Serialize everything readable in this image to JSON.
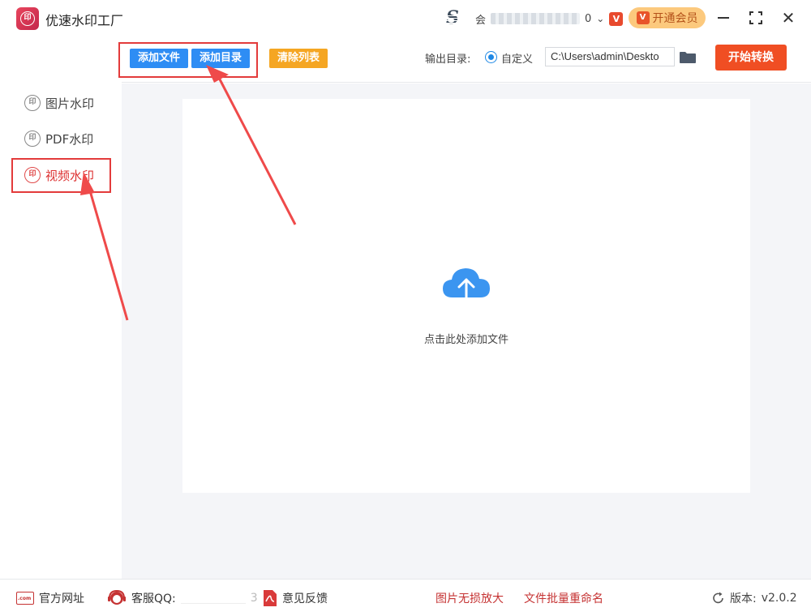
{
  "window": {
    "title": "优速水印工厂",
    "user_name": "会",
    "user_suffix": "0",
    "vip_label": "开通会员"
  },
  "toolbar": {
    "add_file": "添加文件",
    "add_directory": "添加目录",
    "clear_list": "清除列表",
    "output_label": "输出目录:",
    "radio_custom": "自定义",
    "output_path": "C:\\Users\\admin\\Deskto",
    "start_convert": "开始转换"
  },
  "sidebar": {
    "items": [
      {
        "label": "图片水印",
        "active": false
      },
      {
        "label": "PDF水印",
        "active": false
      },
      {
        "label": "视频水印",
        "active": true
      }
    ]
  },
  "main": {
    "drop_text": "点击此处添加文件"
  },
  "bottom": {
    "website": "官方网址",
    "support_qq": "客服QQ:",
    "qq_tail": "3",
    "feedback": "意见反馈",
    "upscale": "图片无损放大",
    "batch_rename": "文件批量重命名",
    "version_label": "版本:",
    "version": "v2.0.2"
  },
  "colors": {
    "primary_blue": "#2e8df4",
    "clear_orange": "#f5a623",
    "start_red": "#f04e23",
    "annotation_red": "#e33b3b"
  }
}
